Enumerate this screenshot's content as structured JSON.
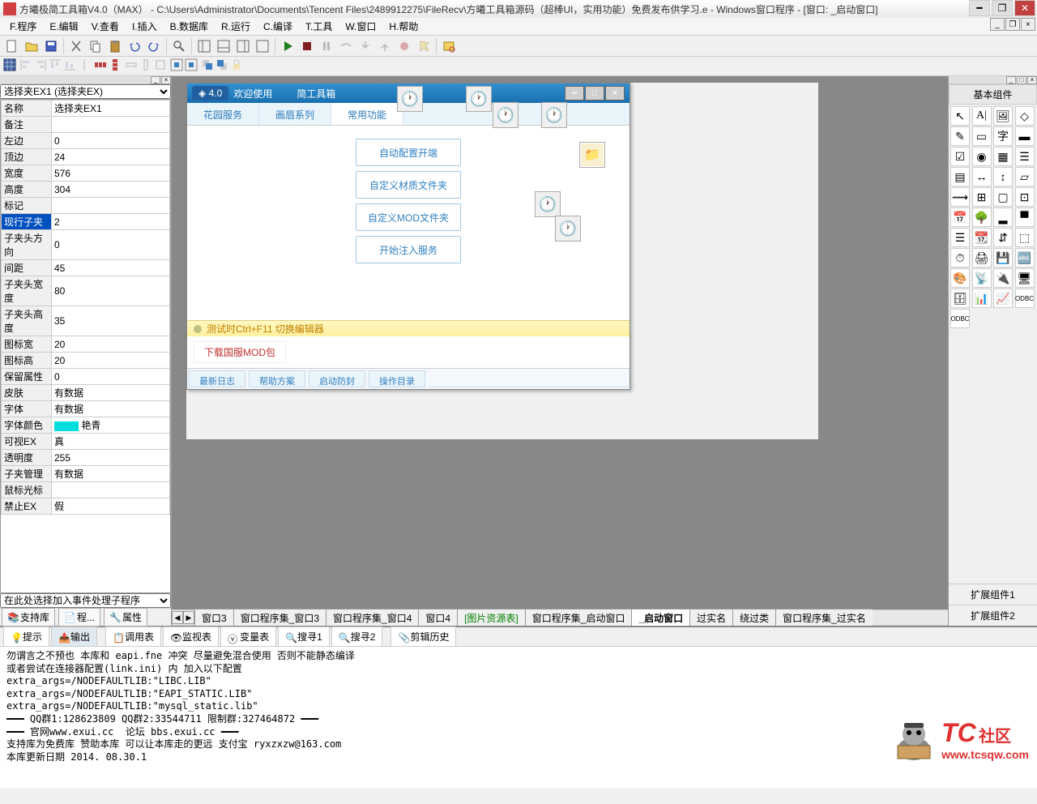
{
  "title": "方曦极简工具箱V4.0（MAX）  -  C:\\Users\\Administrator\\Documents\\Tencent Files\\2489912275\\FileRecv\\方曦工具箱源码（超棒UI，实用功能）免费发布供学习.e - Windows窗口程序 - [窗口: _启动窗口]",
  "menus": [
    "F.程序",
    "E.编辑",
    "V.查看",
    "I.插入",
    "B.数据库",
    "R.运行",
    "C.编译",
    "T.工具",
    "W.窗口",
    "H.帮助"
  ],
  "prop_selector": "选择夹EX1 (选择夹EX)",
  "props": [
    {
      "name": "名称",
      "val": "选择夹EX1"
    },
    {
      "name": "备注",
      "val": ""
    },
    {
      "name": "左边",
      "val": "0"
    },
    {
      "name": "顶边",
      "val": "24"
    },
    {
      "name": "宽度",
      "val": "576"
    },
    {
      "name": "高度",
      "val": "304"
    },
    {
      "name": "标记",
      "val": ""
    },
    {
      "name": "现行子夹",
      "val": "2",
      "sel": true
    },
    {
      "name": "子夹头方向",
      "val": "0"
    },
    {
      "name": "间距",
      "val": "45"
    },
    {
      "name": "子夹头宽度",
      "val": "80"
    },
    {
      "name": "子夹头高度",
      "val": "35"
    },
    {
      "name": "图标宽",
      "val": "20"
    },
    {
      "name": "图标高",
      "val": "20"
    },
    {
      "name": "保留属性",
      "val": "0"
    },
    {
      "name": "皮肤",
      "val": "有数据"
    },
    {
      "name": "字体",
      "val": "有数据"
    },
    {
      "name": "字体颜色",
      "val": "艳青",
      "color": true
    },
    {
      "name": "可视EX",
      "val": "真"
    },
    {
      "name": "透明度",
      "val": "255"
    },
    {
      "name": "子夹管理",
      "val": "有数据"
    },
    {
      "name": "鼠标光标",
      "val": ""
    },
    {
      "name": "禁止EX",
      "val": "假"
    }
  ],
  "evt_placeholder": "在此处选择加入事件处理子程序",
  "left_buttons": [
    "支持库",
    "程...",
    "属性"
  ],
  "mockwin": {
    "title_prefix": "欢迎使用",
    "title_suffix": "简工具箱",
    "version": "4.0",
    "tabs": [
      "花园服务",
      "画眉系列",
      "常用功能"
    ],
    "buttons": [
      "自动配置开端",
      "自定义材质文件夹",
      "自定义MOD文件夹",
      "开始注入服务"
    ],
    "status": "测试时Ctrl+F11 切换编辑器",
    "link": "下载国服MOD包",
    "btabs": [
      "最新日志",
      "帮助方案",
      "启动防封",
      "操作目录"
    ]
  },
  "doctabs": [
    "窗口3",
    "窗口程序集_窗口3",
    "窗口程序集_窗口4",
    "窗口4",
    "[图片资源表]",
    "窗口程序集_启动窗口",
    "_启动窗口",
    "过实名",
    "绕过类",
    "窗口程序集_过实名"
  ],
  "doctab_active": "_启动窗口",
  "doctab_green": "[图片资源表]",
  "toolbox_title": "基本组件",
  "ext1": "扩展组件1",
  "ext2": "扩展组件2",
  "output_tabs": [
    "提示",
    "输出",
    "调用表",
    "监视表",
    "变量表",
    "搜寻1",
    "搜寻2",
    "剪辑历史"
  ],
  "output_text": "勿谓言之不预也 本库和 eapi.fne 冲突 尽量避免混合使用 否则不能静态编译\n或者尝试在连接器配置(link.ini) 内 加入以下配置\nextra_args=/NODEFAULTLIB:\"LIBC.LIB\"\nextra_args=/NODEFAULTLIB:\"EAPI_STATIC.LIB\"\nextra_args=/NODEFAULTLIB:\"mysql_static.lib\"\n━━━ QQ群1:128623809 QQ群2:33544711 限制群:327464872 ━━━\n━━━ 官网www.exui.cc  论坛 bbs.exui.cc ━━━\n支持库为免费库 赞助本库 可以让本库走的更远 支付宝 ryxzxzw@163.com\n本库更新日期 2014. 08.30.1",
  "watermark": {
    "main": "TC",
    "sub1": "社区",
    "url": "www.tcsqw.com"
  }
}
